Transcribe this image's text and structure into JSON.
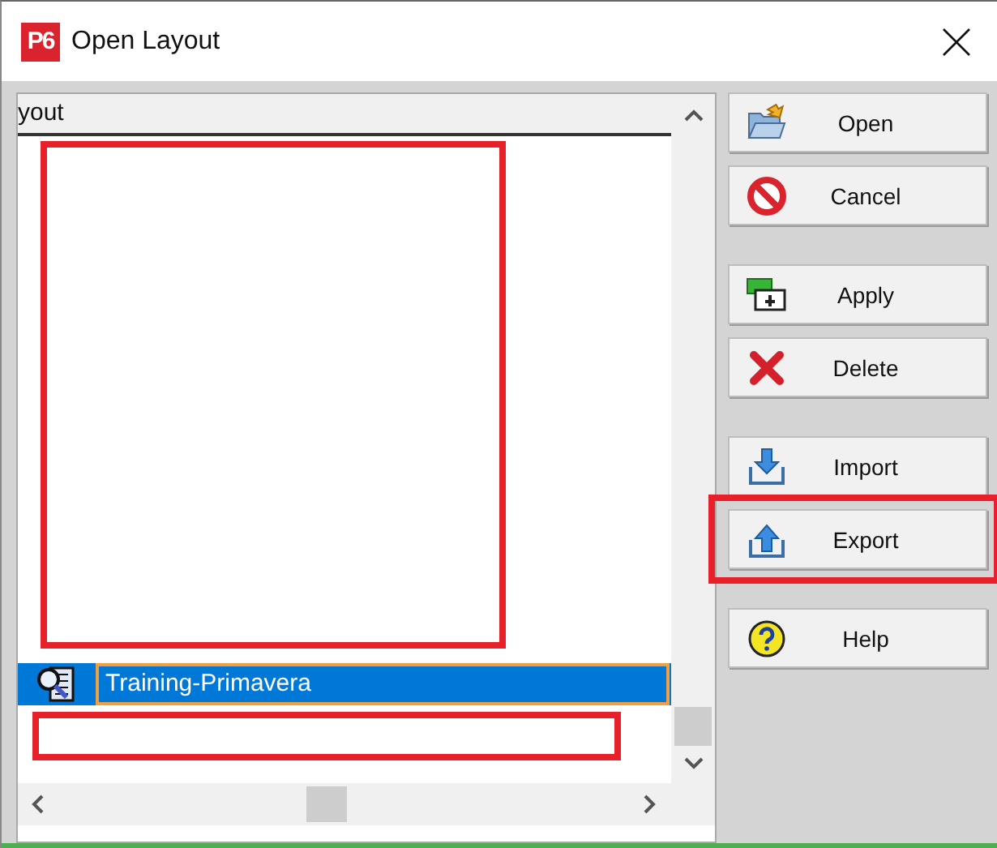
{
  "window": {
    "app_badge": "P6",
    "title": "Open Layout"
  },
  "layout_list": {
    "column_header": "yout",
    "rows": [
      {
        "kind": "redacted_block"
      },
      {
        "kind": "layout",
        "name": "Training-Primavera",
        "selected": true,
        "editing": true
      },
      {
        "kind": "redacted_line"
      }
    ]
  },
  "button_groups": [
    [
      {
        "kind": "open",
        "label": "Open",
        "highlighted": false
      },
      {
        "kind": "cancel",
        "label": "Cancel",
        "highlighted": false
      }
    ],
    [
      {
        "kind": "apply",
        "label": "Apply",
        "highlighted": false
      },
      {
        "kind": "delete",
        "label": "Delete",
        "highlighted": false
      }
    ],
    [
      {
        "kind": "import",
        "label": "Import",
        "highlighted": false
      },
      {
        "kind": "export",
        "label": "Export",
        "highlighted": true
      }
    ],
    [
      {
        "kind": "help",
        "label": "Help",
        "highlighted": false
      }
    ]
  ]
}
